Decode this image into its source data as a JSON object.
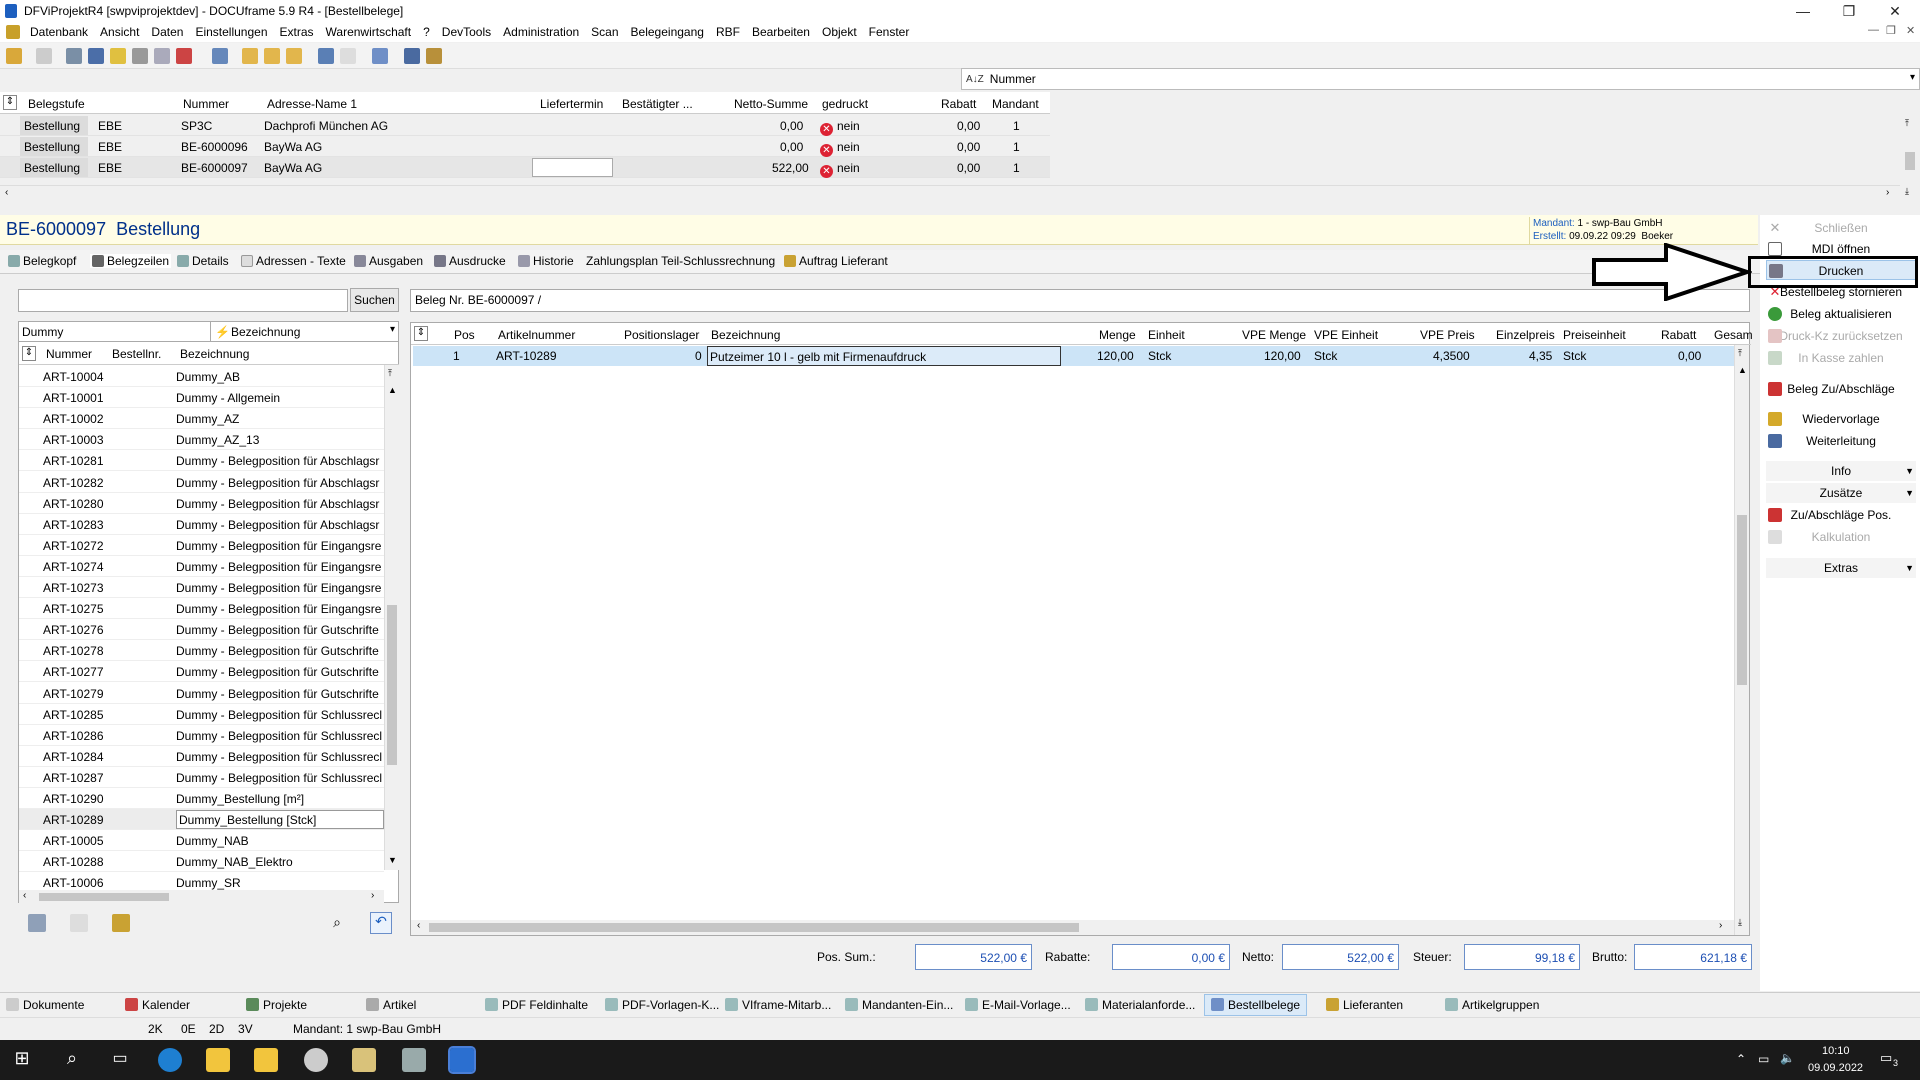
{
  "window": {
    "title": "DFViProjektR4 [swpviprojektdev] - DOCUframe 5.9 R4 - [Bestellbelege]",
    "minimize": "—",
    "maximize": "❐",
    "close": "✕"
  },
  "menu": [
    "Datenbank",
    "Ansicht",
    "Daten",
    "Einstellungen",
    "Extras",
    "Warenwirtschaft",
    "?",
    "DevTools",
    "Administration",
    "Scan",
    "Belegeingang",
    "RBF",
    "Bearbeiten",
    "Objekt",
    "Fenster"
  ],
  "sortbar": {
    "icon": "A-Z sort",
    "label": "Nummer"
  },
  "list": {
    "headers": [
      "Belegstufe",
      "Nummer",
      "Adresse-Name 1",
      "Liefertermin",
      "Bestätigter ...",
      "Netto-Summe",
      "gedruckt",
      "Rabatt",
      "Mandant"
    ],
    "rows": [
      {
        "stufe": "Bestellung",
        "typ": "EBE",
        "nummer": "SP3C",
        "adresse": "Dachprofi München AG",
        "netto": "0,00",
        "gedruckt": "nein",
        "rabatt": "0,00",
        "mandant": "1"
      },
      {
        "stufe": "Bestellung",
        "typ": "EBE",
        "nummer": "BE-6000096",
        "adresse": "BayWa AG",
        "netto": "0,00",
        "gedruckt": "nein",
        "rabatt": "0,00",
        "mandant": "1"
      },
      {
        "stufe": "Bestellung",
        "typ": "EBE",
        "nummer": "BE-6000097",
        "adresse": "BayWa AG",
        "netto": "522,00",
        "gedruckt": "nein",
        "rabatt": "0,00",
        "mandant": "1"
      }
    ]
  },
  "doc": {
    "number": "BE-6000097",
    "type": "Bestellung",
    "mandant_label": "Mandant:",
    "mandant_value": "1 - swp-Bau GmbH",
    "erstellt_label": "Erstellt:",
    "erstellt_value": "09.09.22 09:29  Boeker"
  },
  "tabs": [
    "Belegkopf",
    "Belegzeilen",
    "Details",
    "Adressen - Texte",
    "Ausgaben",
    "Ausdrucke",
    "Historie",
    "Zahlungsplan Teil-Schlussrechnung",
    "Auftrag Lieferant"
  ],
  "search": {
    "value": "",
    "button": "Suchen"
  },
  "beleg_info": "Beleg Nr. BE-6000097 /",
  "left": {
    "filter_value": "Dummy",
    "filter_field": "Bezeichnung",
    "headers": [
      "Nummer",
      "Bestellnr.",
      "Bezeichnung"
    ],
    "rows": [
      [
        "ART-10004",
        "Dummy_AB"
      ],
      [
        "ART-10001",
        "Dummy - Allgemein"
      ],
      [
        "ART-10002",
        "Dummy_AZ"
      ],
      [
        "ART-10003",
        "Dummy_AZ_13"
      ],
      [
        "ART-10281",
        "Dummy - Belegposition für Abschlagsr"
      ],
      [
        "ART-10282",
        "Dummy - Belegposition für Abschlagsr"
      ],
      [
        "ART-10280",
        "Dummy - Belegposition für Abschlagsr"
      ],
      [
        "ART-10283",
        "Dummy - Belegposition für Abschlagsr"
      ],
      [
        "ART-10272",
        "Dummy - Belegposition für Eingangsre"
      ],
      [
        "ART-10274",
        "Dummy - Belegposition für Eingangsre"
      ],
      [
        "ART-10273",
        "Dummy - Belegposition für Eingangsre"
      ],
      [
        "ART-10275",
        "Dummy - Belegposition für Eingangsre"
      ],
      [
        "ART-10276",
        "Dummy - Belegposition für Gutschrifte"
      ],
      [
        "ART-10278",
        "Dummy - Belegposition für Gutschrifte"
      ],
      [
        "ART-10277",
        "Dummy - Belegposition für Gutschrifte"
      ],
      [
        "ART-10279",
        "Dummy - Belegposition für Gutschrifte"
      ],
      [
        "ART-10285",
        "Dummy - Belegposition für Schlussrecl"
      ],
      [
        "ART-10286",
        "Dummy - Belegposition für Schlussrecl"
      ],
      [
        "ART-10284",
        "Dummy - Belegposition für Schlussrecl"
      ],
      [
        "ART-10287",
        "Dummy - Belegposition für Schlussrecl"
      ],
      [
        "ART-10290",
        "Dummy_Bestellung [m²]"
      ],
      [
        "ART-10289",
        "Dummy_Bestellung [Stck]"
      ],
      [
        "ART-10005",
        "Dummy_NAB"
      ],
      [
        "ART-10288",
        "Dummy_NAB_Elektro"
      ],
      [
        "ART-10006",
        "Dummy_SR"
      ]
    ]
  },
  "grid": {
    "headers": [
      "Pos",
      "Artikelnummer",
      "Positionslager",
      "Bezeichnung",
      "Menge",
      "Einheit",
      "VPE Menge",
      "VPE Einheit",
      "VPE Preis",
      "Einzelpreis",
      "Preiseinheit",
      "Rabatt",
      "Gesam"
    ],
    "row": {
      "pos": "1",
      "artikel": "ART-10289",
      "lager": "0",
      "bez": "Putzeimer 10 l - gelb mit Firmenaufdruck",
      "menge": "120,00",
      "einheit": "Stck",
      "vpe_menge": "120,00",
      "vpe_einheit": "Stck",
      "vpe_preis": "4,3500",
      "einzelpreis": "4,35",
      "preiseinheit": "Stck",
      "rabatt": "0,00"
    }
  },
  "totals": {
    "pos_sum_label": "Pos. Sum.:",
    "pos_sum": "522,00 €",
    "rabatte_label": "Rabatte:",
    "rabatte": "0,00 €",
    "netto_label": "Netto:",
    "netto": "522,00 €",
    "steuer_label": "Steuer:",
    "steuer": "99,18 €",
    "brutto_label": "Brutto:",
    "brutto": "621,18 €"
  },
  "right": {
    "schliessen": "Schließen",
    "mdi": "MDI öffnen",
    "drucken": "Drucken",
    "stornieren": "Bestellbeleg stornieren",
    "aktualisieren": "Beleg aktualisieren",
    "druck_kz": "Druck-Kz zurücksetzen",
    "kasse": "In Kasse zahlen",
    "zuab": "Beleg Zu/Abschläge",
    "wiedervorlage": "Wiedervorlage",
    "weiterleitung": "Weiterleitung",
    "info": "Info",
    "zusaetze": "Zusätze",
    "zuabpos": "Zu/Abschläge Pos.",
    "kalkulation": "Kalkulation",
    "extras": "Extras"
  },
  "bottom_tabs": [
    "Dokumente",
    "Kalender",
    "Projekte",
    "Artikel",
    "PDF Feldinhalte",
    "PDF-Vorlagen-K...",
    "VIframe-Mitarb...",
    "Mandanten-Ein...",
    "E-Mail-Vorlage...",
    "Materialanforde...",
    "Bestellbelege",
    "Lieferanten",
    "Artikelgruppen"
  ],
  "status": {
    "a": "2K",
    "b": "0E",
    "c": "2D",
    "d": "3V",
    "mandant": "Mandant: 1 swp-Bau GmbH"
  },
  "clock": {
    "time": "10:10",
    "date": "09.09.2022",
    "notif": "3"
  },
  "colors": {
    "accent": "#00308a",
    "selection": "#cce4f7",
    "highlight_border": "#000000"
  }
}
